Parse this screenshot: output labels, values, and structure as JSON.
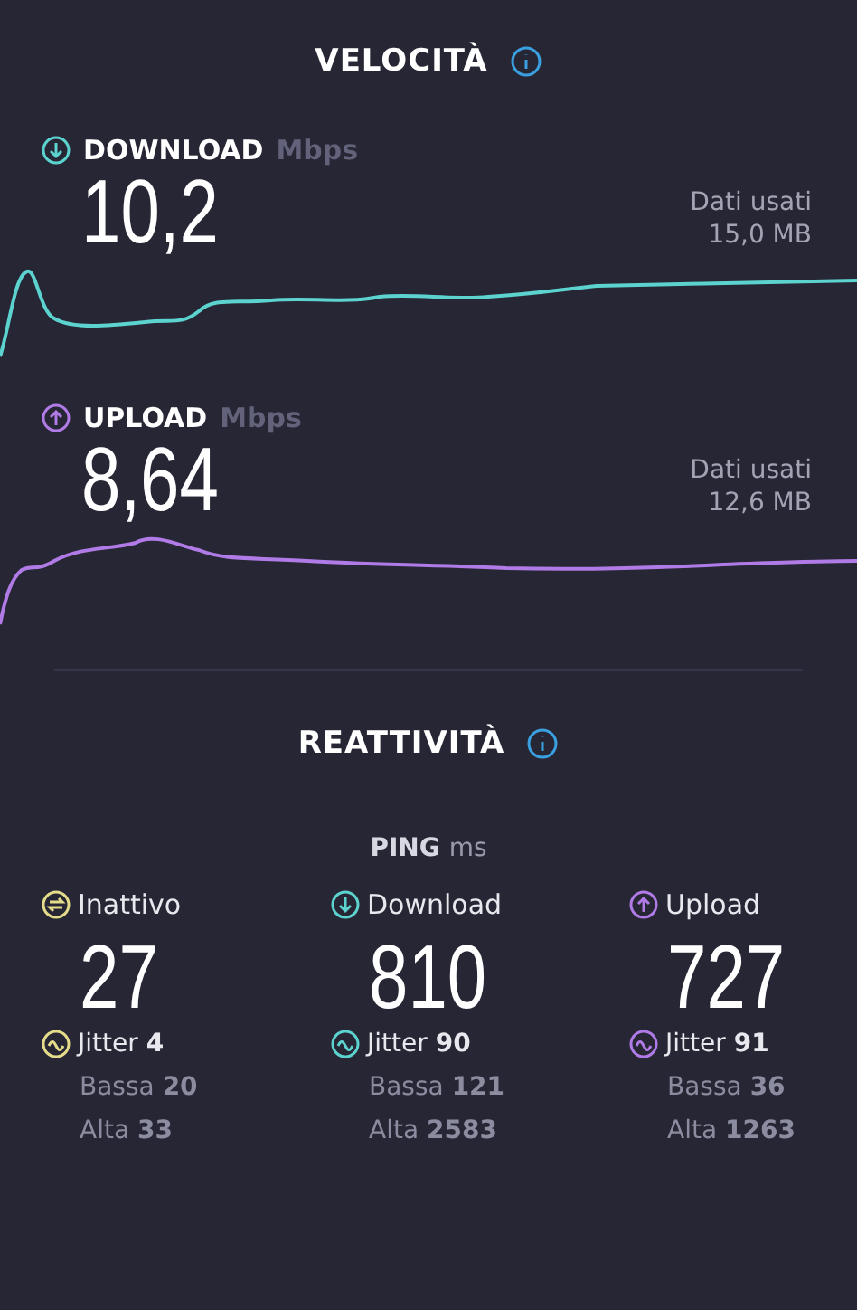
{
  "speed": {
    "title": "VELOCITÀ",
    "metrics": [
      {
        "kind": "download",
        "label": "DOWNLOAD",
        "unit": "Mbps",
        "value": "10,2",
        "data_label": "Dati usati",
        "data_value": "15,0 MB"
      },
      {
        "kind": "upload",
        "label": "UPLOAD",
        "unit": "Mbps",
        "value": "8,64",
        "data_label": "Dati usati",
        "data_value": "12,6 MB"
      }
    ]
  },
  "responsiveness": {
    "title": "REATTIVITÀ",
    "ping_label": "PING",
    "ping_unit": "ms",
    "columns": [
      {
        "kind": "idle",
        "label": "Inattivo",
        "value": "27",
        "jitter": "Jitter **4**",
        "low": "Bassa **20**",
        "high": "Alta **33**"
      },
      {
        "kind": "download",
        "label": "Download",
        "value": "810",
        "jitter": "Jitter **90**",
        "low": "Bassa **121**",
        "high": "Alta **2583**"
      },
      {
        "kind": "upload",
        "label": "Upload",
        "value": "727",
        "jitter": "Jitter **91**",
        "low": "Bassa **36**",
        "high": "Alta **1263**"
      }
    ]
  }
}
